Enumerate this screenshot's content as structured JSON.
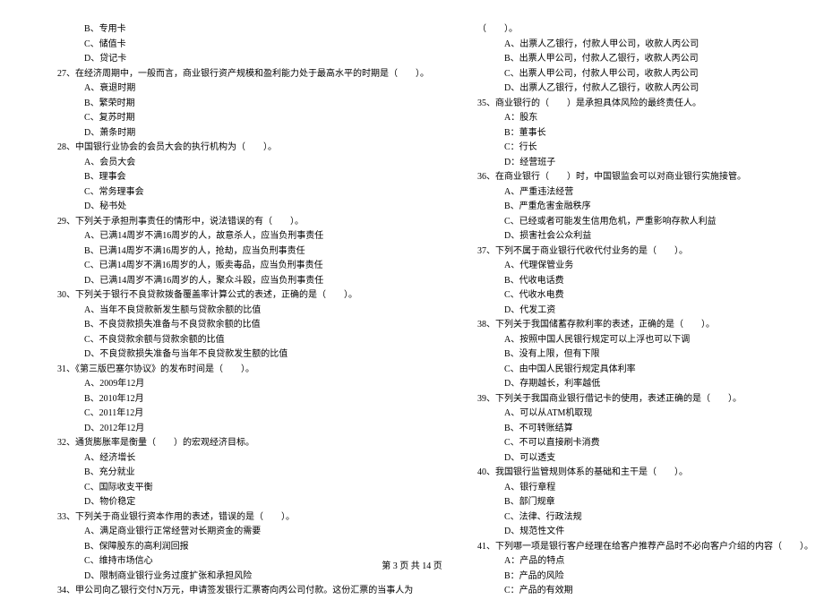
{
  "left_column": [
    {
      "cls": "option",
      "text": "B、专用卡"
    },
    {
      "cls": "option",
      "text": "C、储值卡"
    },
    {
      "cls": "option",
      "text": "D、贷记卡"
    },
    {
      "cls": "question",
      "text": "27、在经济周期中，一般而言，商业银行资产规模和盈利能力处于最高水平的时期是（　　）。"
    },
    {
      "cls": "option",
      "text": "A、衰退时期"
    },
    {
      "cls": "option",
      "text": "B、繁荣时期"
    },
    {
      "cls": "option",
      "text": "C、复苏时期"
    },
    {
      "cls": "option",
      "text": "D、萧条时期"
    },
    {
      "cls": "question",
      "text": "28、中国银行业协会的会员大会的执行机构为（　　）。"
    },
    {
      "cls": "option",
      "text": "A、会员大会"
    },
    {
      "cls": "option",
      "text": "B、理事会"
    },
    {
      "cls": "option",
      "text": "C、常务理事会"
    },
    {
      "cls": "option",
      "text": "D、秘书处"
    },
    {
      "cls": "question",
      "text": "29、下列关于承担刑事责任的情形中，说法错误的有（　　）。"
    },
    {
      "cls": "option",
      "text": "A、已满14周岁不满16周岁的人，故意杀人，应当负刑事责任"
    },
    {
      "cls": "option",
      "text": "B、已满14周岁不满16周岁的人，抢劫，应当负刑事责任"
    },
    {
      "cls": "option",
      "text": "C、已满14周岁不满16周岁的人，贩卖毒品，应当负刑事责任"
    },
    {
      "cls": "option",
      "text": "D、已满14周岁不满16周岁的人，聚众斗殴，应当负刑事责任"
    },
    {
      "cls": "question",
      "text": "30、下列关于银行不良贷款拨备覆盖率计算公式的表述，正确的是（　　）。"
    },
    {
      "cls": "option",
      "text": "A、当年不良贷款新发生额与贷款余额的比值"
    },
    {
      "cls": "option",
      "text": "B、不良贷款损失准备与不良贷款余额的比值"
    },
    {
      "cls": "option",
      "text": "C、不良贷款余额与贷款余额的比值"
    },
    {
      "cls": "option",
      "text": "D、不良贷款损失准备与当年不良贷款发生额的比值"
    },
    {
      "cls": "question",
      "text": "31、《第三版巴塞尔协议》的发布时间是（　　）。"
    },
    {
      "cls": "option",
      "text": "A、2009年12月"
    },
    {
      "cls": "option",
      "text": "B、2010年12月"
    },
    {
      "cls": "option",
      "text": "C、2011年12月"
    },
    {
      "cls": "option",
      "text": "D、2012年12月"
    },
    {
      "cls": "question",
      "text": "32、通货膨胀率是衡量（　　）的宏观经济目标。"
    },
    {
      "cls": "option",
      "text": "A、经济增长"
    },
    {
      "cls": "option",
      "text": "B、充分就业"
    },
    {
      "cls": "option",
      "text": "C、国际收支平衡"
    },
    {
      "cls": "option",
      "text": "D、物价稳定"
    },
    {
      "cls": "question",
      "text": "33、下列关于商业银行资本作用的表述，错误的是（　　）。"
    },
    {
      "cls": "option",
      "text": "A、满足商业银行正常经营对长期资金的需要"
    },
    {
      "cls": "option",
      "text": "B、保障股东的高利润回报"
    },
    {
      "cls": "option",
      "text": "C、维持市场信心"
    },
    {
      "cls": "option",
      "text": "D、限制商业银行业务过度扩张和承担风险"
    },
    {
      "cls": "question",
      "text": "34、甲公司向乙银行交付N万元，申请签发银行汇票寄向丙公司付款。这份汇票的当事人为"
    }
  ],
  "right_column": [
    {
      "cls": "question",
      "text": "（　　）。"
    },
    {
      "cls": "option",
      "text": "A、出票人乙银行，付款人甲公司，收款人丙公司"
    },
    {
      "cls": "option",
      "text": "B、出票人甲公司，付款人乙银行，收款人丙公司"
    },
    {
      "cls": "option",
      "text": "C、出票人甲公司，付款人甲公司，收款人丙公司"
    },
    {
      "cls": "option",
      "text": "D、出票人乙银行，付款人乙银行，收款人丙公司"
    },
    {
      "cls": "question",
      "text": "35、商业银行的（　　）是承担具体风险的最终责任人。"
    },
    {
      "cls": "option",
      "text": "A：股东"
    },
    {
      "cls": "option",
      "text": "B：董事长"
    },
    {
      "cls": "option",
      "text": "C：行长"
    },
    {
      "cls": "option",
      "text": "D：经营班子"
    },
    {
      "cls": "question",
      "text": "36、在商业银行（　　）时，中国银监会可以对商业银行实施接管。"
    },
    {
      "cls": "option",
      "text": "A、严重违法经营"
    },
    {
      "cls": "option",
      "text": "B、严重危害金融秩序"
    },
    {
      "cls": "option",
      "text": "C、已经或者可能发生信用危机，严重影响存款人利益"
    },
    {
      "cls": "option",
      "text": "D、损害社会公众利益"
    },
    {
      "cls": "question",
      "text": "37、下列不属于商业银行代收代付业务的是（　　）。"
    },
    {
      "cls": "option",
      "text": "A、代理保管业务"
    },
    {
      "cls": "option",
      "text": "B、代收电话费"
    },
    {
      "cls": "option",
      "text": "C、代收水电费"
    },
    {
      "cls": "option",
      "text": "D、代发工资"
    },
    {
      "cls": "question",
      "text": "38、下列关于我国储蓄存款利率的表述，正确的是（　　）。"
    },
    {
      "cls": "option",
      "text": "A、按照中国人民银行规定可以上浮也可以下调"
    },
    {
      "cls": "option",
      "text": "B、没有上限，但有下限"
    },
    {
      "cls": "option",
      "text": "C、由中国人民银行规定具体利率"
    },
    {
      "cls": "option",
      "text": "D、存期越长，利率越低"
    },
    {
      "cls": "question",
      "text": "39、下列关于我国商业银行借记卡的使用，表述正确的是（　　）。"
    },
    {
      "cls": "option",
      "text": "A、可以从ATM机取现"
    },
    {
      "cls": "option",
      "text": "B、不可转账结算"
    },
    {
      "cls": "option",
      "text": "C、不可以直接刷卡消费"
    },
    {
      "cls": "option",
      "text": "D、可以透支"
    },
    {
      "cls": "question",
      "text": "40、我国银行监管规则体系的基础和主干是（　　）。"
    },
    {
      "cls": "option",
      "text": "A、银行章程"
    },
    {
      "cls": "option",
      "text": "B、部门规章"
    },
    {
      "cls": "option",
      "text": "C、法律、行政法规"
    },
    {
      "cls": "option",
      "text": "D、规范性文件"
    },
    {
      "cls": "question",
      "text": "41、下列哪一项是银行客户经理在给客户推荐产品时不必向客户介绍的内容（　　）。"
    },
    {
      "cls": "option",
      "text": "A：产品的特点"
    },
    {
      "cls": "option",
      "text": "B：产品的风险"
    },
    {
      "cls": "option",
      "text": "C：产品的有效期"
    }
  ],
  "footer": "第 3 页 共 14 页"
}
